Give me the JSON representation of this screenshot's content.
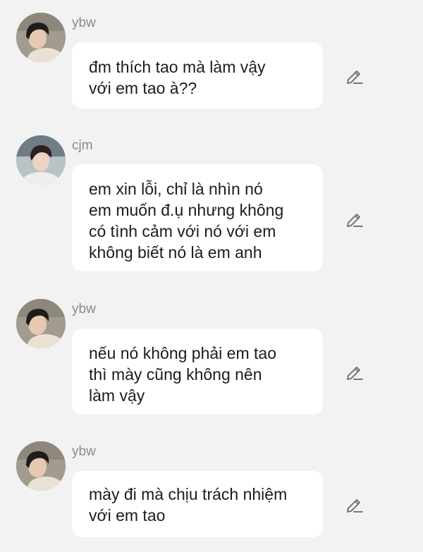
{
  "colors": {
    "background": "#f2f2f2",
    "bubble": "#ffffff",
    "username": "#8a8a8a",
    "text": "#1c1c1c",
    "icon": "#777777"
  },
  "messages": [
    {
      "username": "ybw",
      "avatar": "avatar-ybw",
      "text": "đm thích tao mà làm vậy\nvới em tao à??",
      "icon": "pencil-icon"
    },
    {
      "username": "cjm",
      "avatar": "avatar-cjm",
      "text": "em xin lỗi, chỉ là nhìn nó\nem muốn đ.ụ nhưng không\ncó tình cảm với nó với em\nkhông biết nó là em anh",
      "icon": "pencil-icon"
    },
    {
      "username": "ybw",
      "avatar": "avatar-ybw",
      "text": "nếu nó không phải em tao\nthì mày cũng không nên\nlàm vậy",
      "icon": "pencil-icon"
    },
    {
      "username": "ybw",
      "avatar": "avatar-ybw",
      "text": "mày đi mà chịu trách nhiệm\nvới em tao",
      "icon": "pencil-icon"
    }
  ]
}
